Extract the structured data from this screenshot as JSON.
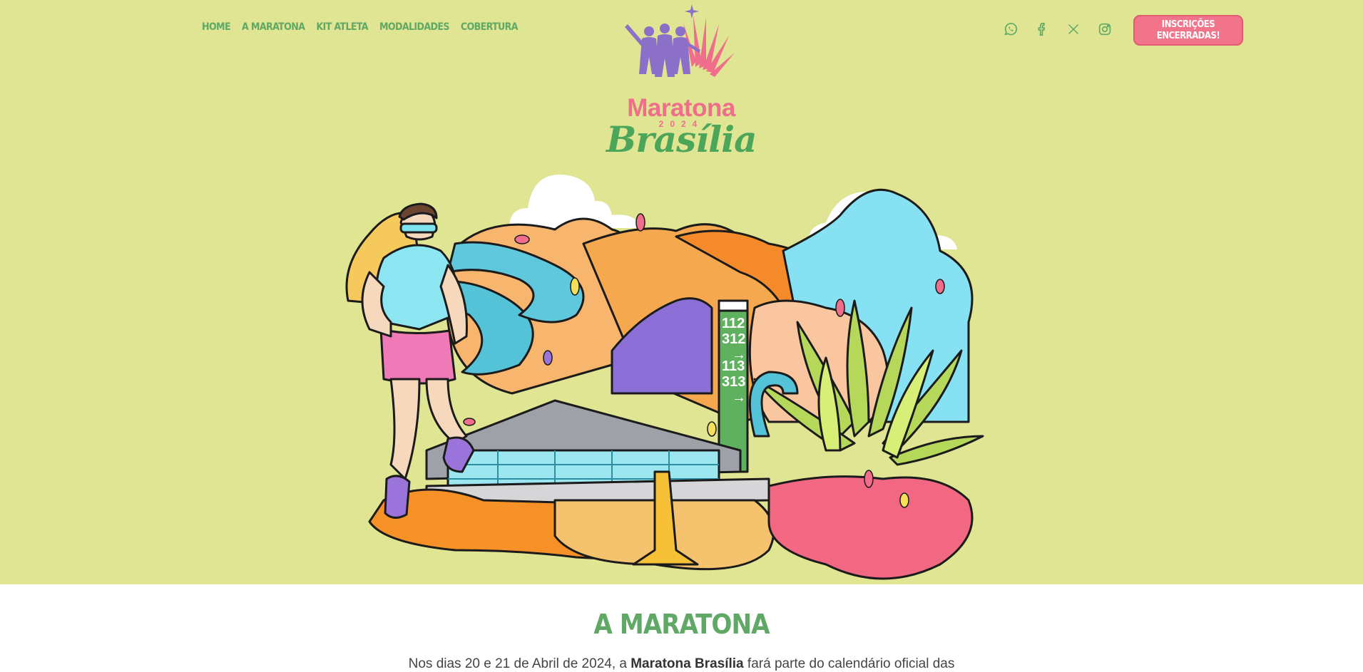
{
  "nav": {
    "items": [
      {
        "label": "HOME"
      },
      {
        "label": "A MARATONA"
      },
      {
        "label": "KIT ATLETA"
      },
      {
        "label": "MODALIDADES"
      },
      {
        "label": "COBERTURA"
      }
    ]
  },
  "logo": {
    "word1": "Maratona",
    "year": "2024",
    "word2": "Brasília"
  },
  "socials": {
    "icons": [
      "whatsapp-icon",
      "facebook-icon",
      "x-icon",
      "instagram-icon"
    ]
  },
  "cta": {
    "line1": "INSCRIÇÕES",
    "line2": "ENCERRADAS!"
  },
  "illustration": {
    "sign_top": "112",
    "sign_mid": "312",
    "sign_low": "113",
    "sign_bottom": "313"
  },
  "section": {
    "title": "A MARATONA",
    "intro_before": "Nos dias 20 e 21 de Abril de 2024, a ",
    "intro_bold": "Maratona Brasília",
    "intro_after": " fará parte do calendário oficial das"
  },
  "colors": {
    "hero_bg": "#dfe592",
    "accent_green": "#5fa865",
    "cta_pink": "#f2748a"
  }
}
